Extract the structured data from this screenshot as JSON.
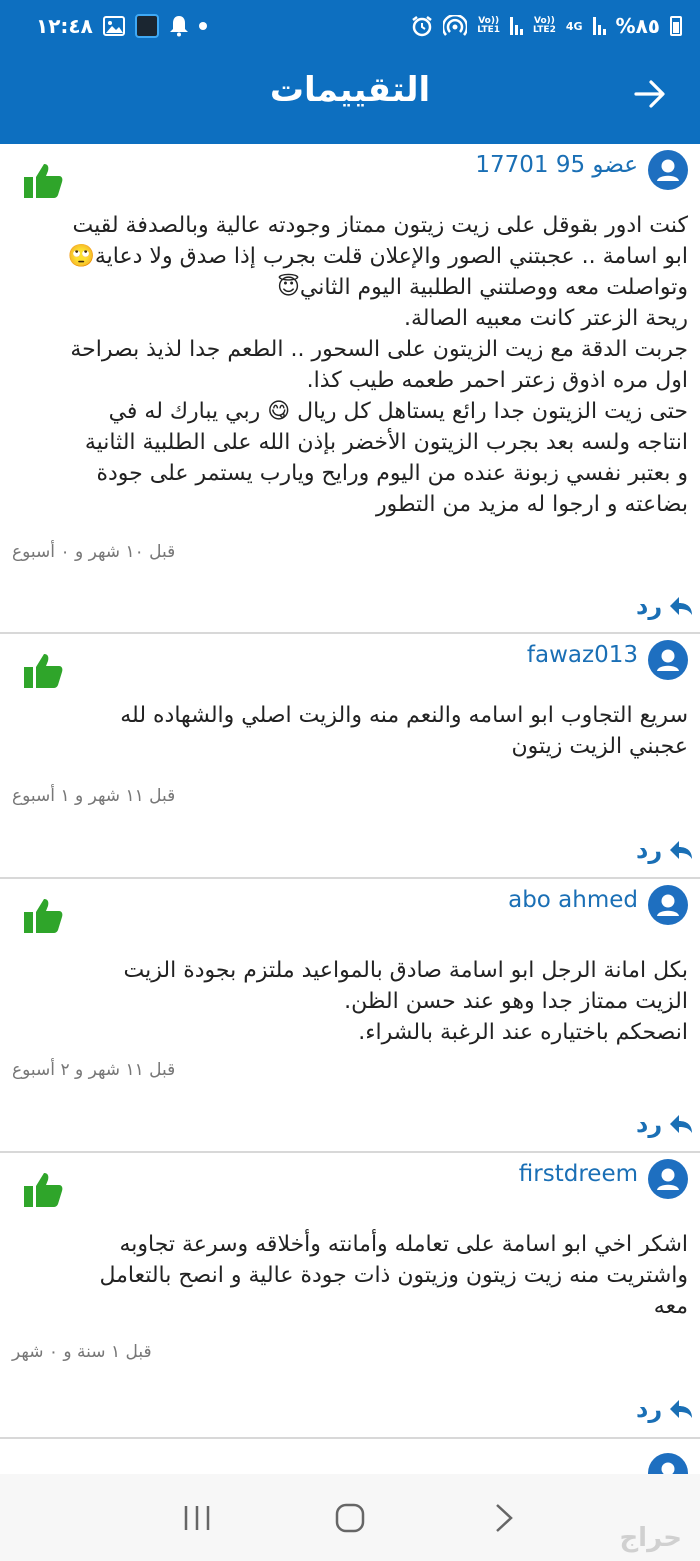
{
  "status_bar": {
    "time": "١٢:٤٨",
    "battery": "%٨٥",
    "network_1": "4G",
    "lte_1": "LTE2",
    "volte_1": "Vo))",
    "lte_2": "LTE1",
    "volte_2": "Vo))"
  },
  "header": {
    "title": "التقييمات",
    "back_icon": "arrow-right-icon"
  },
  "reviews": [
    {
      "user": "عضو 95 17701",
      "text": [
        "كنت ادور بقوقل على زيت زيتون ممتاز وجودته عالية وبالصدفة لقيت",
        "ابو اسامة .. عجبتني الصور والإعلان قلت بجرب إذا صدق ولا دعاية🙄",
        "وتواصلت معه ووصلتني الطلبية اليوم الثاني😇",
        "ريحة الزعتر كانت معبيه الصالة.",
        "جربت الدقة مع زيت الزيتون على السحور .. الطعم جدا  لذيذ بصراحة",
        "اول مره اذوق زعتر احمر طعمه طيب كذا.",
        "حتى زيت الزيتون جدا  رائع يستاهل كل ريال 😋 ربي يبارك له في",
        "انتاجه ولسه بعد بجرب الزيتون الأخضر بإذن الله على الطلبية الثانية",
        "و بعتبر نفسي زبونة عنده من اليوم ورايح ويارب يستمر على جودة",
        "بضاعته و ارجوا له مزيد من التطور"
      ],
      "time": "قبل ١٠ شهر و ٠ أسبوع",
      "reply": "رد"
    },
    {
      "user": "fawaz013",
      "text": [
        "سريع التجاوب ابو اسامه والنعم منه والزيت اصلي والشهاده لله",
        "عجبني الزيت زيتون"
      ],
      "time": "قبل ١١ شهر و ١ أسبوع",
      "reply": "رد"
    },
    {
      "user": "abo ahmed",
      "text": [
        "بكل امانة الرجل ابو اسامة صادق بالمواعيد ملتزم بجودة الزيت",
        "الزيت ممتاز جدا وهو عند حسن الظن.",
        "انصحكم باختياره عند الرغبة بالشراء."
      ],
      "time": "قبل ١١ شهر و ٢ أسبوع",
      "reply": "رد"
    },
    {
      "user": "firstdreem",
      "text": [
        "اشكر اخي ابو اسامة على تعامله وأمانته وأخلاقه وسرعة تجاوبه",
        "واشتريت منه زيت زيتون وزيتون ذات جودة عالية و انصح بالتعامل",
        "معه"
      ],
      "time": "قبل ١ سنة و ٠ شهر",
      "reply": "رد"
    }
  ],
  "colors": {
    "primary": "#0d6fc0",
    "link": "#1a6fb5",
    "like": "#2fa52a"
  },
  "watermark": "حراج"
}
